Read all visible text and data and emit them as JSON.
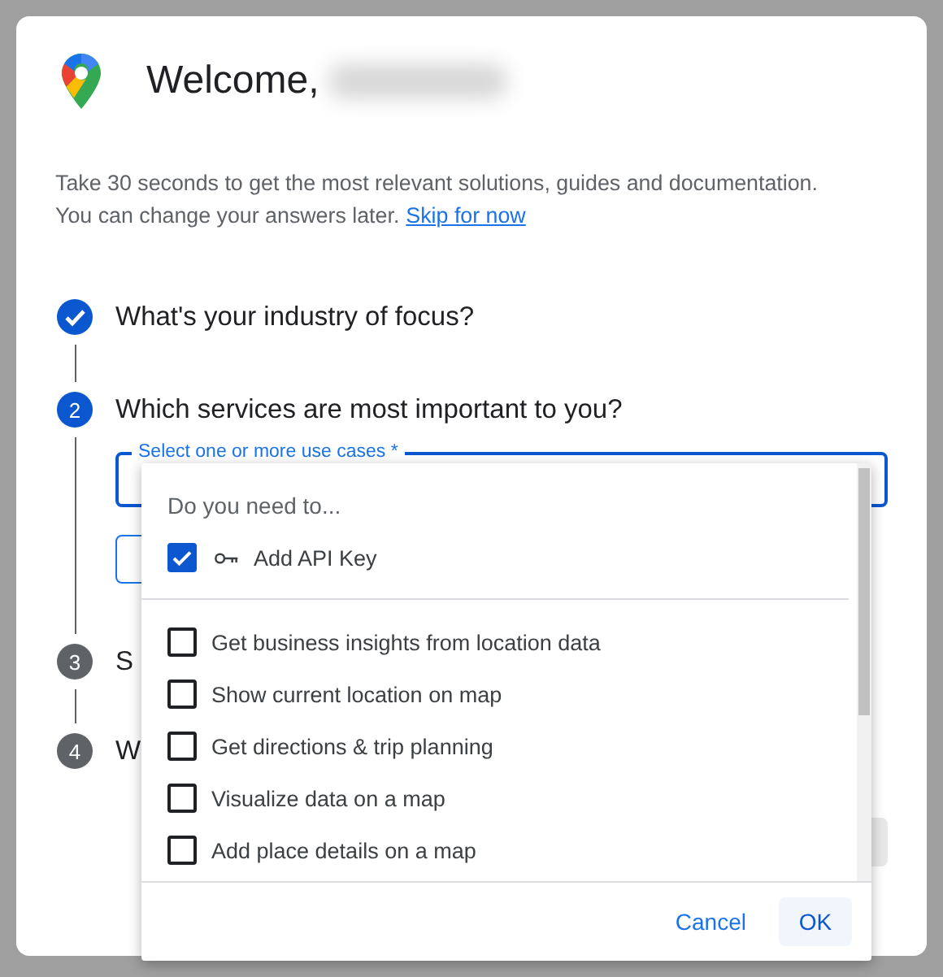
{
  "header": {
    "title": "Welcome,"
  },
  "intro": {
    "lines": [
      "Take 30 seconds to get the most relevant solutions, guides and documentation.",
      "You can change your answers later."
    ],
    "link": "Skip for now"
  },
  "steps": [
    {
      "completed": true,
      "active": false,
      "title": "What's your industry of focus?"
    },
    {
      "number": "2",
      "completed": false,
      "active": true,
      "title": "Which services are most important to you?"
    },
    {
      "number": "3",
      "completed": false,
      "active": false,
      "title": "S"
    },
    {
      "number": "4",
      "completed": false,
      "active": false,
      "title": "W"
    }
  ],
  "use_case_field": {
    "label": "Select one or more use cases *"
  },
  "dropdown": {
    "heading": "Do you need to...",
    "options": [
      {
        "label": "Add API Key",
        "checked": true,
        "kind": "key"
      },
      {
        "label": "Get business insights from location data",
        "checked": false,
        "kind": "plain"
      },
      {
        "label": "Show current location on map",
        "checked": false,
        "kind": "plain"
      },
      {
        "label": "Get directions & trip planning",
        "checked": false,
        "kind": "plain"
      },
      {
        "label": "Visualize data on a map",
        "checked": false,
        "kind": "plain"
      },
      {
        "label": "Add place details on a map",
        "checked": false,
        "kind": "plain"
      }
    ],
    "buttons": [
      {
        "label": "Cancel",
        "kind": "text"
      },
      {
        "label": "OK",
        "kind": "tonal"
      }
    ]
  }
}
